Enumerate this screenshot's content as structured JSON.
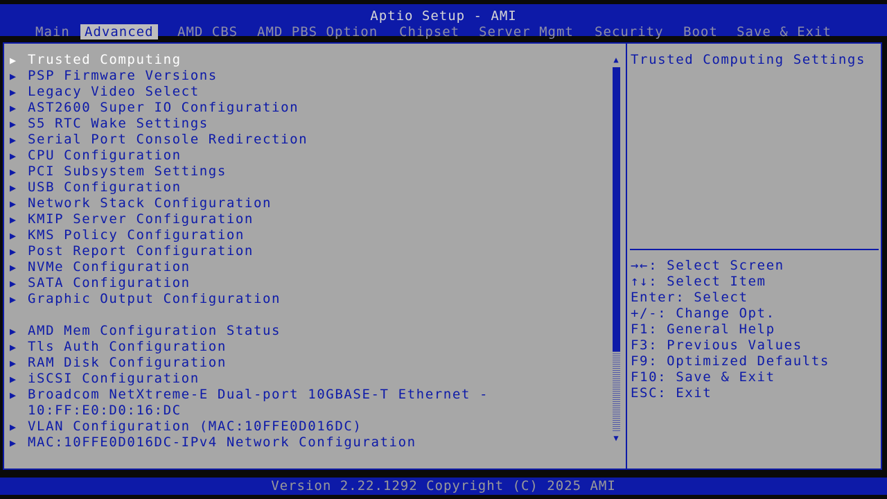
{
  "header": {
    "title": "Aptio Setup - AMI",
    "tabs": [
      "Main",
      "Advanced",
      "AMD CBS",
      "AMD PBS Option",
      "Chipset",
      "Server Mgmt",
      "Security",
      "Boot",
      "Save & Exit"
    ],
    "active_tab": "Advanced"
  },
  "menu": {
    "items": [
      "Trusted Computing",
      "PSP Firmware Versions",
      "Legacy Video Select",
      "AST2600 Super IO Configuration",
      "S5 RTC Wake Settings",
      "Serial Port Console Redirection",
      "CPU Configuration",
      "PCI Subsystem Settings",
      "USB Configuration",
      "Network Stack Configuration",
      "KMIP Server Configuration",
      "KMS Policy Configuration",
      "Post Report Configuration",
      "NVMe Configuration",
      "SATA Configuration",
      "Graphic Output Configuration",
      "AMD Mem Configuration Status",
      "Tls Auth Configuration",
      "RAM Disk Configuration",
      "iSCSI Configuration",
      "Broadcom NetXtreme-E Dual-port 10GBASE-T Ethernet -",
      "10:FF:E0:D0:16:DC",
      "VLAN Configuration (MAC:10FFE0D016DC)",
      "MAC:10FFE0D016DC-IPv4 Network Configuration"
    ],
    "selected_item": "Trusted Computing",
    "arrow_glyph": "▶"
  },
  "help": {
    "text": "Trusted Computing Settings",
    "keys": [
      "→←: Select Screen",
      "↑↓: Select Item",
      "Enter: Select",
      "+/-: Change Opt.",
      "F1: General Help",
      "F3: Previous Values",
      "F9: Optimized Defaults",
      "F10: Save & Exit",
      "ESC: Exit"
    ]
  },
  "scrollbar": {
    "up_glyph": "▲",
    "down_glyph": "▼",
    "position_fraction": 0.0,
    "visible_fraction": 0.78
  },
  "footer": {
    "text": "Version 2.22.1292 Copyright (C) 2025 AMI"
  },
  "colors": {
    "bar_blue": "#0d1aa8",
    "panel_gray": "#a7a7a7",
    "selected_text": "#ffffff",
    "inactive_tab_text": "#8e8ea6"
  }
}
